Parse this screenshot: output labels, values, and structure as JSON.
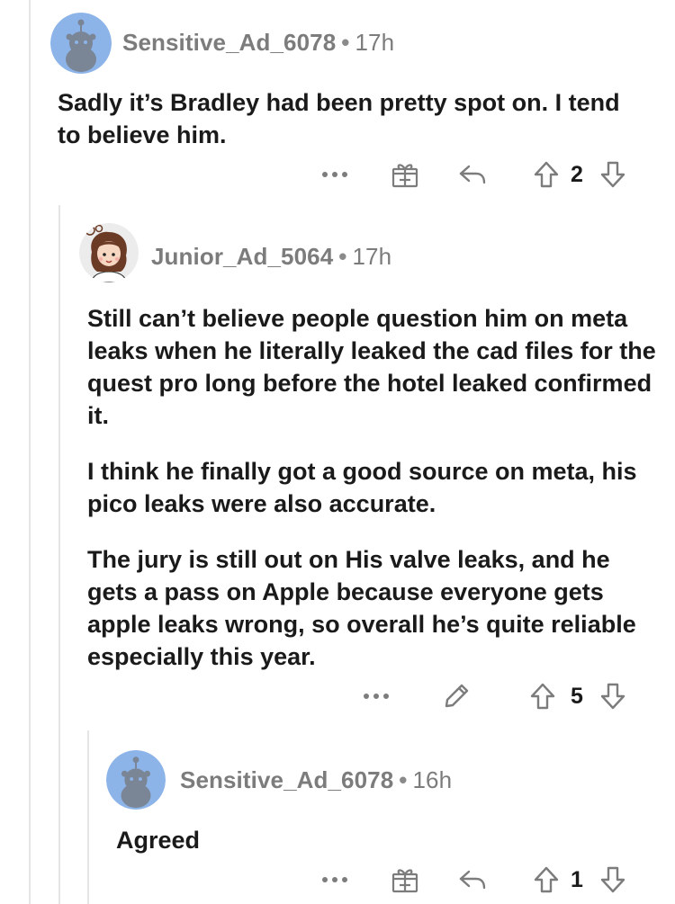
{
  "comments": [
    {
      "username": "Sensitive_Ad_6078",
      "separator": "•",
      "time": "17h",
      "paragraphs": [
        "Sadly it’s Bradley had been pretty spot on. I tend to believe him."
      ],
      "score": "2",
      "actions": [
        "more",
        "award",
        "reply",
        "upvote",
        "downvote"
      ]
    },
    {
      "username": "Junior_Ad_5064",
      "separator": "•",
      "time": "17h",
      "paragraphs": [
        "Still can’t believe people question him on meta leaks when he literally leaked the cad files for the quest pro long before the hotel leaked confirmed it.",
        "I think he finally got a good source on meta, his pico leaks were also accurate.",
        "The jury is still out on His valve leaks, and he gets a pass on Apple because everyone gets apple leaks wrong, so overall he’s quite reliable especially this year."
      ],
      "score": "5",
      "actions": [
        "more",
        "edit",
        "upvote",
        "downvote"
      ]
    },
    {
      "username": "Sensitive_Ad_6078",
      "separator": "•",
      "time": "16h",
      "paragraphs": [
        "Agreed"
      ],
      "score": "1",
      "actions": [
        "more",
        "award",
        "reply",
        "upvote",
        "downvote"
      ]
    }
  ],
  "colors": {
    "avatar_blue": "#8cb4e8",
    "snoo_gray": "#7a8596",
    "meta_gray": "#7c7c7c",
    "text": "#1a1a1b",
    "thread_line": "#e5e5e5"
  }
}
